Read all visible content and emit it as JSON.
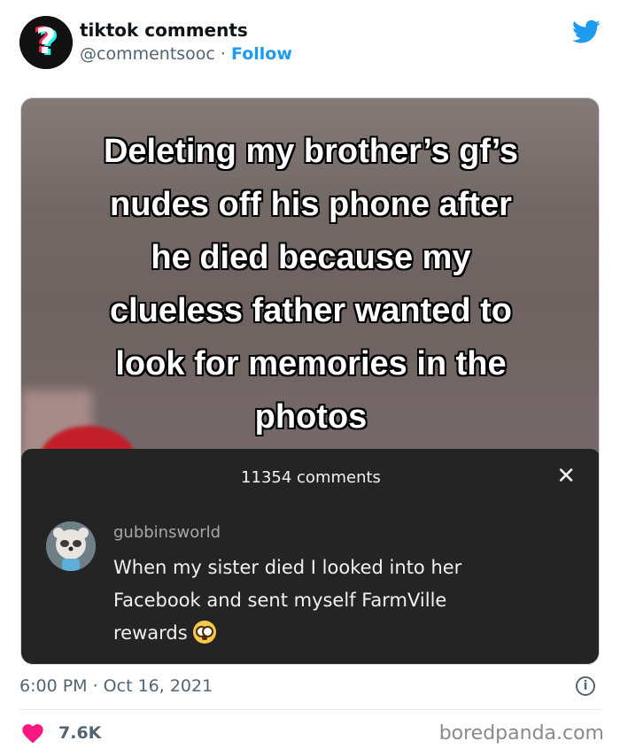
{
  "tweet": {
    "author_name": "tiktok comments",
    "author_handle": "@commentsooc",
    "separator": "·",
    "follow_label": "Follow",
    "brand_icon": "twitter-bird-icon",
    "accent_color": "#1d9bf0",
    "timestamp": "6:00 PM · Oct 16, 2021",
    "likes": "7.6K",
    "heart_color": "#f91880"
  },
  "media": {
    "caption": "Deleting my brother’s gf’s\nnudes off his phone after\nhe died because my\nclueless father wanted to\nlook for memories in the\nphotos",
    "comments_panel": {
      "title": "11354 comments",
      "close_icon": "close-icon",
      "comment": {
        "username": "gubbinsworld",
        "text": "When my sister died I looked into her Facebook and sent myself FarmVille rewards",
        "emoji": "flushed-face-emoji"
      }
    }
  },
  "watermark": "boredpanda.com"
}
